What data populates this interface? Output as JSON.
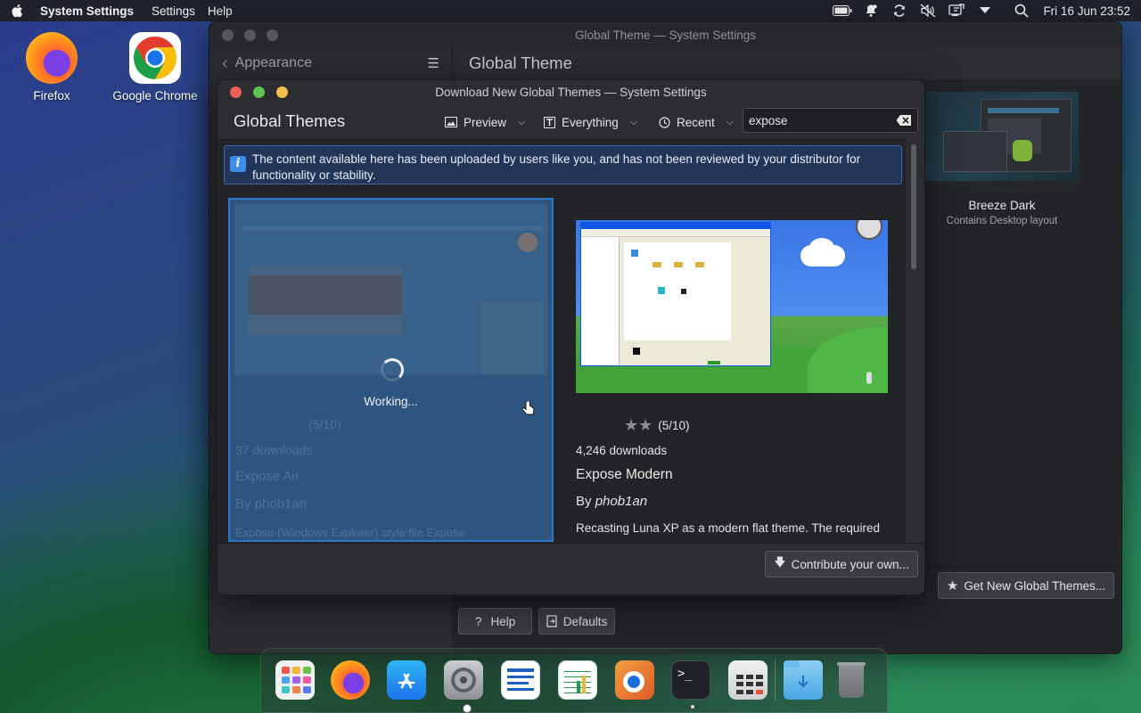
{
  "menubar": {
    "app_name": "System Settings",
    "menus": [
      "Settings",
      "Help"
    ],
    "clock": "Fri 16 Jun 23:52",
    "tray_icons": [
      "battery-icon",
      "notifications-icon",
      "sync-icon",
      "volume-muted-icon",
      "clipboard-icon",
      "chevron-down-icon",
      "search-icon"
    ]
  },
  "desktop": {
    "icons": [
      {
        "label": "Firefox",
        "icon": "firefox-icon"
      },
      {
        "label": "Google Chrome",
        "icon": "chrome-icon"
      }
    ]
  },
  "settings_window": {
    "title": "Global Theme — System Settings",
    "sidebar_title": "Appearance",
    "main_title": "Global Theme",
    "theme_card": {
      "name": "Breeze Dark",
      "subtitle": "Contains Desktop layout"
    },
    "buttons": {
      "get_new": "Get New Global Themes...",
      "help": "Help",
      "defaults": "Defaults"
    }
  },
  "dialog": {
    "title": "Download New Global Themes — System Settings",
    "heading": "Global Themes",
    "toolbar": {
      "view_mode": "Preview",
      "filter": "Everything",
      "sort": "Recent"
    },
    "search": {
      "value": "expose"
    },
    "info_banner": "The content available here has been uploaded by users like you, and has not been reviewed by your distributor for functionality or stability.",
    "cards": [
      {
        "state": "Working...",
        "ghost_downloads": "37 downloads",
        "ghost_name": "Expose Air",
        "ghost_author": "By phob1an",
        "ghost_desc": "Expose (Windows Explorer) style file Expose",
        "ghost_rating": "(5/10)"
      },
      {
        "rating_text": "(5/10)",
        "rating_stars": 2,
        "downloads": "4,246 downloads",
        "name": "Expose Modern",
        "author_prefix": "By",
        "author": "phob1an",
        "description": "Recasting Luna XP as a modern flat theme. The required"
      }
    ],
    "footer_button": "Contribute your own..."
  },
  "dock": {
    "items": [
      "launchpad-icon",
      "firefox-icon",
      "app-store-icon",
      "system-settings-icon",
      "text-editor-icon",
      "spreadsheet-icon",
      "photo-viewer-icon",
      "terminal-icon",
      "calculator-icon",
      "downloads-folder-icon",
      "trash-icon"
    ]
  },
  "colors": {
    "accent": "#3d8ee8",
    "selection_border": "#2f76c6",
    "traffic_close": "#ed5e5a",
    "traffic_min": "#f4bf4f",
    "traffic_max": "#60c454"
  }
}
